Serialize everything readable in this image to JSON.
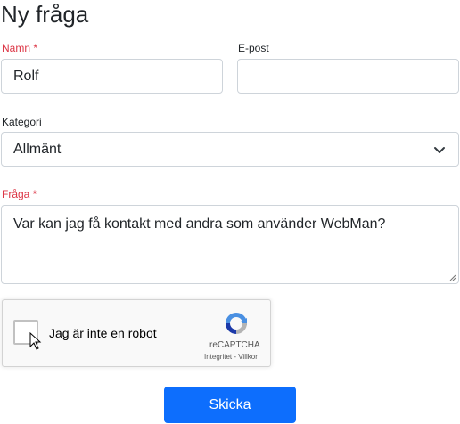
{
  "page": {
    "title": "Ny fråga"
  },
  "form": {
    "name": {
      "label": "Namn *",
      "value": "Rolf"
    },
    "email": {
      "label": "E-post",
      "value": ""
    },
    "category": {
      "label": "Kategori",
      "selected": "Allmänt"
    },
    "question": {
      "label": "Fråga *",
      "value": "Var kan jag få kontakt med andra som använder WebMan?"
    },
    "submit_label": "Skicka"
  },
  "captcha": {
    "label": "Jag är inte en robot",
    "brand": "reCAPTCHA",
    "links": "Integritet - Villkor"
  },
  "colors": {
    "required": "#dc3545",
    "primary": "#0d6efd",
    "border": "#ced4da"
  },
  "icons": [
    "chevron-down-icon",
    "recaptcha-logo-icon",
    "resize-grip-icon",
    "mouse-cursor-icon"
  ]
}
